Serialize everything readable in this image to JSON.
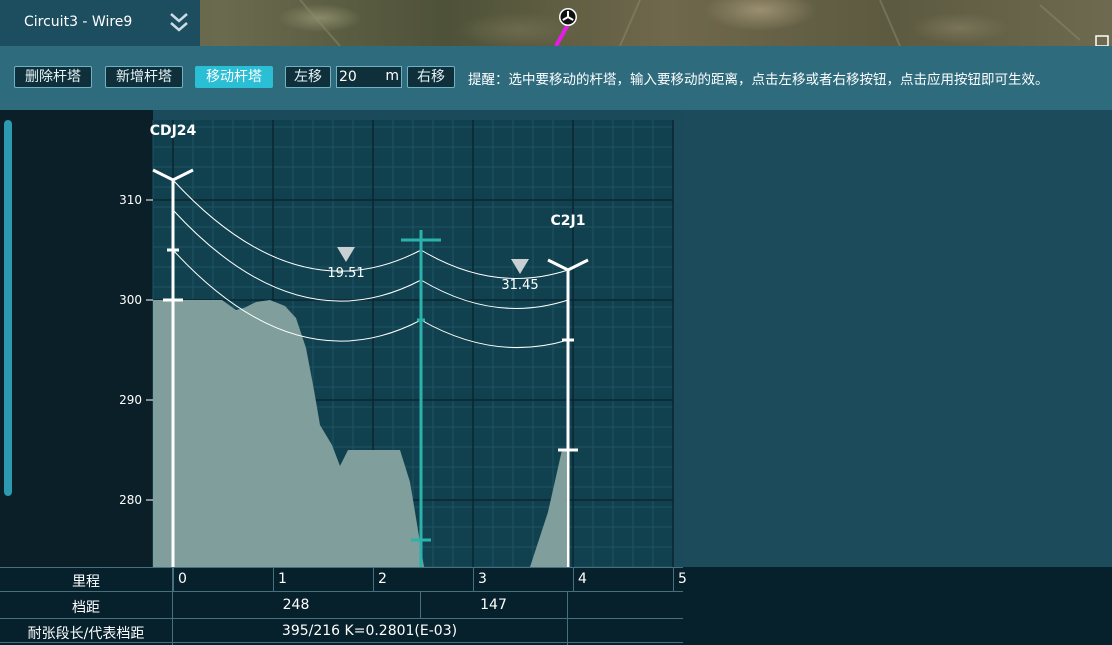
{
  "header": {
    "title": "Circuit3 - Wire9"
  },
  "toolbar": {
    "delete_label": "删除杆塔",
    "add_label": "新增杆塔",
    "move_label": "移动杆塔",
    "left_label": "左移",
    "distance_value": "20",
    "distance_unit": "m",
    "right_label": "右移",
    "hint": "提醒：选中要移动的杆塔，输入要移动的距离，点击左移或者右移按钮，点击应用按钮即可生效。"
  },
  "chart_data": {
    "type": "profile",
    "y_ticks": [
      "280",
      "290",
      "300",
      "310"
    ],
    "ylim": [
      274,
      318
    ],
    "x_ticks": [
      "0",
      "1",
      "2",
      "3",
      "4",
      "5"
    ],
    "grid": true,
    "towers": [
      {
        "name": "CDJ24",
        "x": 0.0,
        "top": 312
      },
      {
        "name": "",
        "x": 2.48,
        "top": 307
      },
      {
        "name": "C2J1",
        "x": 3.95,
        "top": 303
      }
    ],
    "sag_labels": [
      {
        "value": "19.51",
        "x": 1.73
      },
      {
        "value": "31.45",
        "x": 3.47
      }
    ]
  },
  "table": {
    "mileage_label": "里程",
    "span_label": "档距",
    "tension_label": "耐张段长/代表档距",
    "spans": [
      "248",
      "147"
    ],
    "tension_value": "395/216 K=0.2801(E-03)"
  },
  "colors": {
    "selected_tower": "#2ab3aa",
    "terrain": "#7f9e9c",
    "active_button": "#2bbfd6"
  }
}
